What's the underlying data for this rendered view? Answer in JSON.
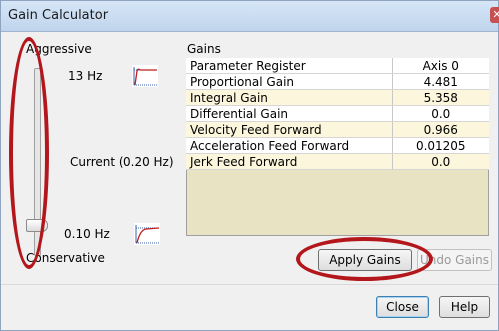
{
  "window": {
    "title": "Gain Calculator",
    "close_glyph": "✕"
  },
  "left_panel": {
    "top_label": "Aggressive",
    "bottom_label": "Conservative",
    "high_freq": "13 Hz",
    "current_label": "Current (",
    "current_value": "0.20 Hz)",
    "low_freq": "0.10 Hz",
    "slider_position": 0.86
  },
  "gains": {
    "group_label": "Gains",
    "columns": [
      "Parameter Register",
      "Axis 0"
    ],
    "rows": [
      {
        "name": "Proportional Gain",
        "value": "4.481"
      },
      {
        "name": "Integral Gain",
        "value": "5.358"
      },
      {
        "name": "Differential Gain",
        "value": "0.0"
      },
      {
        "name": "Velocity Feed Forward",
        "value": "0.966"
      },
      {
        "name": "Acceleration Feed Forward",
        "value": "0.01205"
      },
      {
        "name": "Jerk Feed Forward",
        "value": "0.0"
      }
    ]
  },
  "buttons": {
    "apply": "Apply Gains",
    "undo": "Undo Gains",
    "close": "Close",
    "help": "Help"
  },
  "colors": {
    "highlight_oval": "#b3171b",
    "table_fill": "#e8e3c3"
  },
  "icons": [
    "step-response-fast-icon",
    "step-response-slow-icon"
  ]
}
